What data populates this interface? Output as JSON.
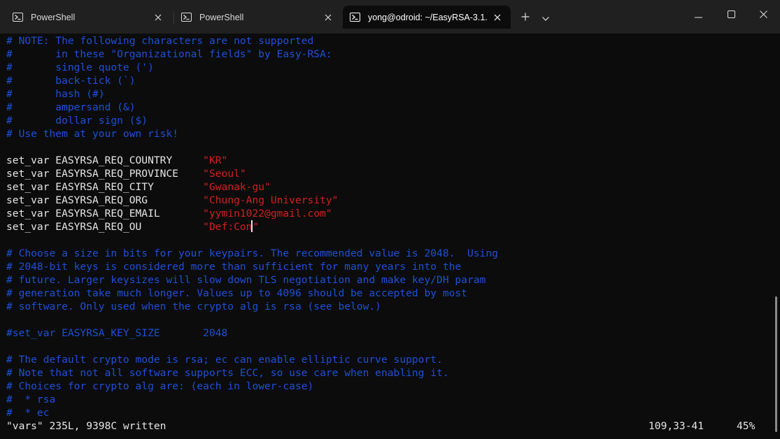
{
  "tabs": [
    {
      "label": "PowerShell",
      "icon": "powershell-icon",
      "active": false
    },
    {
      "label": "PowerShell",
      "icon": "powershell-icon",
      "active": false
    },
    {
      "label": "yong@odroid: ~/EasyRSA-3.1.",
      "icon": "powershell-icon",
      "active": true
    }
  ],
  "toolbar": {
    "new_tab_icon": "plus-icon",
    "dropdown_icon": "chevron-down-icon"
  },
  "window_controls": {
    "minimize_icon": "minimize-icon",
    "maximize_icon": "maximize-icon",
    "close_icon": "close-icon"
  },
  "editor": {
    "lines": [
      {
        "segments": [
          {
            "text": "# NOTE: The following characters are not supported",
            "kind": "comment"
          }
        ]
      },
      {
        "segments": [
          {
            "text": "#       in these \"Organizational fields\" by Easy-RSA:",
            "kind": "comment"
          }
        ]
      },
      {
        "segments": [
          {
            "text": "#       single quote (')",
            "kind": "comment"
          }
        ]
      },
      {
        "segments": [
          {
            "text": "#       back-tick (`)",
            "kind": "comment"
          }
        ]
      },
      {
        "segments": [
          {
            "text": "#       hash (#)",
            "kind": "comment"
          }
        ]
      },
      {
        "segments": [
          {
            "text": "#       ampersand (&)",
            "kind": "comment"
          }
        ]
      },
      {
        "segments": [
          {
            "text": "#       dollar sign ($)",
            "kind": "comment"
          }
        ]
      },
      {
        "segments": [
          {
            "text": "# Use them at your own risk!",
            "kind": "comment"
          }
        ]
      },
      {
        "segments": []
      },
      {
        "segments": [
          {
            "text": "set_var EASYRSA_REQ_COUNTRY     ",
            "kind": "plain"
          },
          {
            "text": "\"KR\"",
            "kind": "string"
          }
        ]
      },
      {
        "segments": [
          {
            "text": "set_var EASYRSA_REQ_PROVINCE    ",
            "kind": "plain"
          },
          {
            "text": "\"Seoul\"",
            "kind": "string"
          }
        ]
      },
      {
        "segments": [
          {
            "text": "set_var EASYRSA_REQ_CITY        ",
            "kind": "plain"
          },
          {
            "text": "\"Gwanak-gu\"",
            "kind": "string"
          }
        ]
      },
      {
        "segments": [
          {
            "text": "set_var EASYRSA_REQ_ORG         ",
            "kind": "plain"
          },
          {
            "text": "\"Chung-Ang University\"",
            "kind": "string"
          }
        ]
      },
      {
        "segments": [
          {
            "text": "set_var EASYRSA_REQ_EMAIL       ",
            "kind": "plain"
          },
          {
            "text": "\"yymin1022@gmail.com\"",
            "kind": "string"
          }
        ]
      },
      {
        "segments": [
          {
            "text": "set_var EASYRSA_REQ_OU          ",
            "kind": "plain"
          },
          {
            "text": "\"Def:Con",
            "kind": "string"
          },
          {
            "text": "",
            "kind": "cursor"
          },
          {
            "text": "\"",
            "kind": "string"
          }
        ]
      },
      {
        "segments": []
      },
      {
        "segments": [
          {
            "text": "# Choose a size in bits for your keypairs. The recommended value is 2048.  Using",
            "kind": "comment"
          }
        ]
      },
      {
        "segments": [
          {
            "text": "# 2048-bit keys is considered more than sufficient for many years into the",
            "kind": "comment"
          }
        ]
      },
      {
        "segments": [
          {
            "text": "# future. Larger keysizes will slow down TLS negotiation and make key/DH param",
            "kind": "comment"
          }
        ]
      },
      {
        "segments": [
          {
            "text": "# generation take much longer. Values up to 4096 should be accepted by most",
            "kind": "comment"
          }
        ]
      },
      {
        "segments": [
          {
            "text": "# software. Only used when the crypto alg is rsa (see below.)",
            "kind": "comment"
          }
        ]
      },
      {
        "segments": []
      },
      {
        "segments": [
          {
            "text": "#set_var EASYRSA_KEY_SIZE       2048",
            "kind": "comment"
          }
        ]
      },
      {
        "segments": []
      },
      {
        "segments": [
          {
            "text": "# The default crypto mode is rsa; ec can enable elliptic curve support.",
            "kind": "comment"
          }
        ]
      },
      {
        "segments": [
          {
            "text": "# Note that not all software supports ECC, so use care when enabling it.",
            "kind": "comment"
          }
        ]
      },
      {
        "segments": [
          {
            "text": "# Choices for crypto alg are: (each in lower-case)",
            "kind": "comment"
          }
        ]
      },
      {
        "segments": [
          {
            "text": "#  * rsa",
            "kind": "comment"
          }
        ]
      },
      {
        "segments": [
          {
            "text": "#  * ec",
            "kind": "comment"
          }
        ]
      }
    ]
  },
  "statusline": {
    "message": "\"vars\" 235L, 9398C written",
    "position": "109,33-41",
    "percent": "45%"
  },
  "scroll_position_fraction": 0.45,
  "colors": {
    "comment": "#1f4fd8",
    "string": "#d22020",
    "plain": "#e6e6e6",
    "background": "#0c0c0c",
    "titlebar": "#202020"
  }
}
